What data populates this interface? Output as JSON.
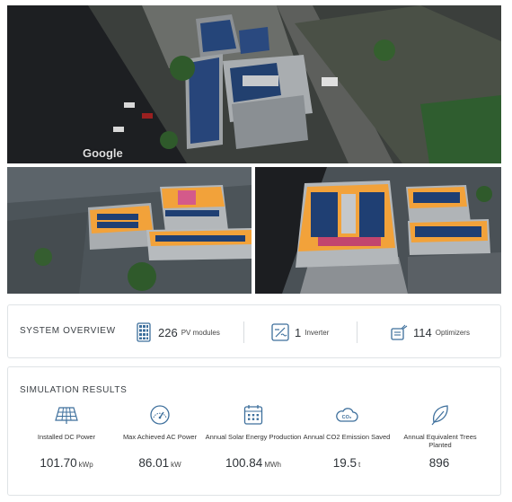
{
  "imagery": {
    "watermark": "Google"
  },
  "system_overview": {
    "title": "SYSTEM OVERVIEW",
    "items": [
      {
        "icon": "solar-panel-icon",
        "count": "226",
        "label": "PV modules"
      },
      {
        "icon": "inverter-icon",
        "count": "1",
        "label": "Inverter"
      },
      {
        "icon": "optimizer-icon",
        "count": "114",
        "label": "Optimizers"
      }
    ]
  },
  "simulation_results": {
    "title": "SIMULATION RESULTS",
    "metrics": [
      {
        "icon": "solar-array-icon",
        "label": "Installed DC Power",
        "value": "101.70",
        "unit": "kWp"
      },
      {
        "icon": "gauge-icon",
        "label": "Max Achieved AC Power",
        "value": "86.01",
        "unit": "kW"
      },
      {
        "icon": "calendar-icon",
        "label": "Annual Solar Energy Production",
        "value": "100.84",
        "unit": "MWh"
      },
      {
        "icon": "co2-cloud-icon",
        "label": "Annual CO2 Emission Saved",
        "value": "19.5",
        "unit": "t"
      },
      {
        "icon": "leaf-icon",
        "label": "Annual Equivalent Trees Planted",
        "value": "896",
        "unit": ""
      }
    ]
  },
  "colors": {
    "accent": "#3d6f9c",
    "rooftop_orange": "#f2a23a",
    "panel_blue": "#1f3f73"
  }
}
